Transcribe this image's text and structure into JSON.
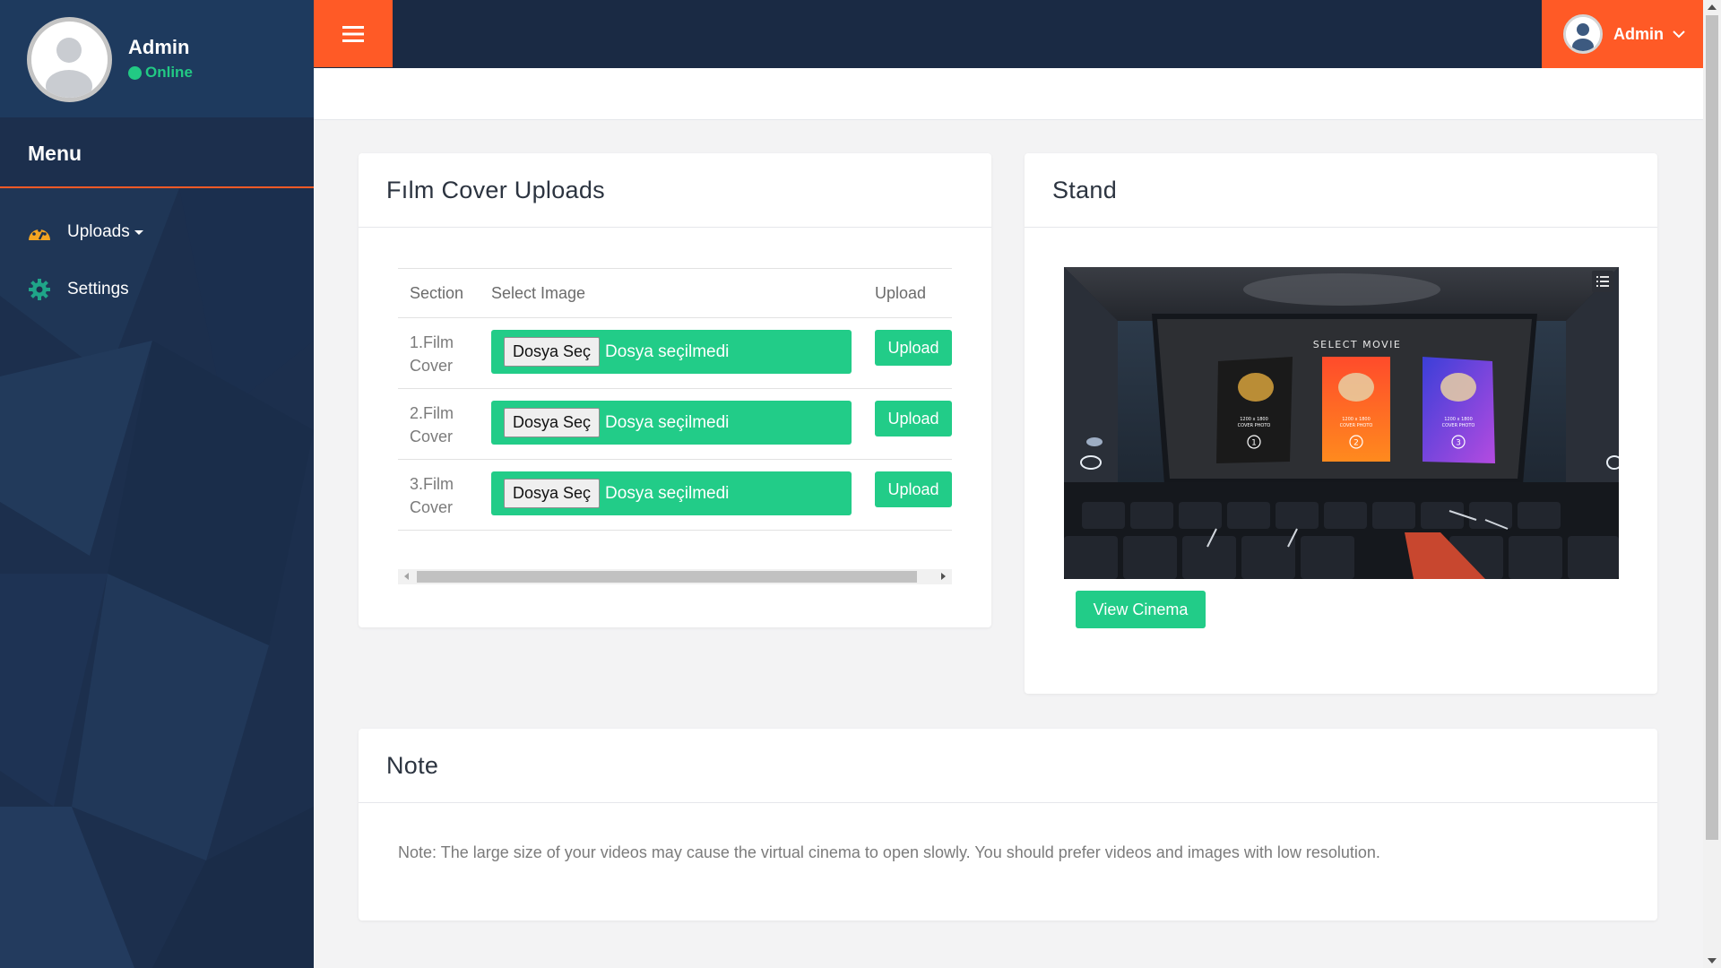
{
  "profile": {
    "name": "Admin",
    "status": "Online"
  },
  "sidebar": {
    "menu_title": "Menu",
    "items": [
      {
        "label": "Uploads",
        "icon": "dashboard-gauge-icon"
      },
      {
        "label": "Settings",
        "icon": "gear-icon"
      }
    ]
  },
  "topbar": {
    "user_label": "Admin"
  },
  "uploads_card": {
    "title": "Fılm Cover Uploads",
    "columns": [
      "Section",
      "Select Image",
      "Upload"
    ],
    "rows": [
      {
        "section": "1.Film Cover",
        "file_button": "Dosya Seç",
        "file_status": "Dosya seçilmedi",
        "upload_label": "Upload"
      },
      {
        "section": "2.Film Cover",
        "file_button": "Dosya Seç",
        "file_status": "Dosya seçilmedi",
        "upload_label": "Upload"
      },
      {
        "section": "3.Film Cover",
        "file_button": "Dosya Seç",
        "file_status": "Dosya seçilmedi",
        "upload_label": "Upload"
      }
    ]
  },
  "stand_card": {
    "title": "Stand",
    "screen_heading": "SELECT MOVIE",
    "poster_labels": [
      "1200 x 1800\nCOVER PHOTO",
      "1200 x 1800\nCOVER PHOTO",
      "1200 x 1800\nCOVER PHOTO"
    ],
    "poster_numbers": [
      "1",
      "2",
      "3"
    ],
    "view_button": "View Cinema"
  },
  "note_card": {
    "title": "Note",
    "text": "Note: The large size of your videos may cause the virtual cinema to open slowly. You should prefer videos and images with low resolution."
  },
  "colors": {
    "accent": "#ff5a26",
    "success": "#22cc88",
    "sidebar": "#1c2f4d",
    "topbar": "#1a2a44"
  }
}
